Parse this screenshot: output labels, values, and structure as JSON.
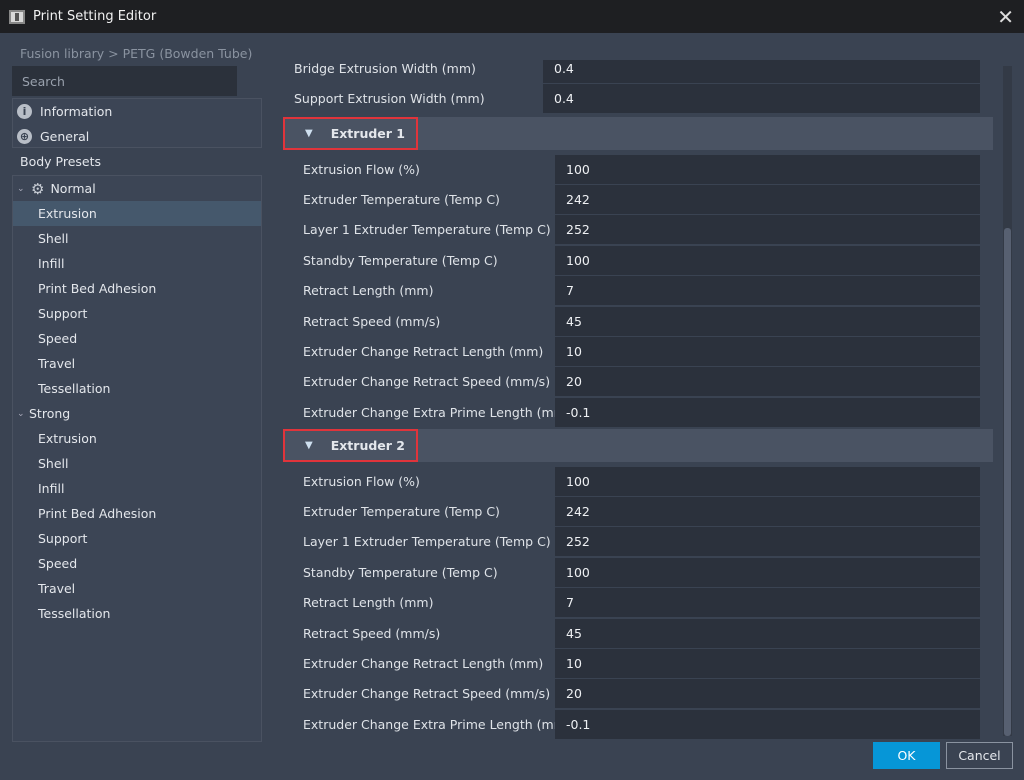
{
  "window": {
    "title": "Print Setting Editor",
    "close_icon": "close-icon"
  },
  "sidebar": {
    "breadcrumb": "Fusion library > PETG (Bowden Tube)",
    "search_placeholder": "Search",
    "top_items": [
      {
        "label": "Information",
        "icon": "info-icon"
      },
      {
        "label": "General",
        "icon": "globe-icon"
      }
    ],
    "body_presets_label": "Body Presets",
    "presets": [
      {
        "label": "Normal",
        "items": [
          "Extrusion",
          "Shell",
          "Infill",
          "Print Bed Adhesion",
          "Support",
          "Speed",
          "Travel",
          "Tessellation"
        ],
        "selected": "Extrusion"
      },
      {
        "label": "Strong",
        "items": [
          "Extrusion",
          "Shell",
          "Infill",
          "Print Bed Adhesion",
          "Support",
          "Speed",
          "Travel",
          "Tessellation"
        ]
      }
    ]
  },
  "main": {
    "pre_rows": [
      {
        "label": "Bridge Extrusion Width (mm)",
        "value": "0.4"
      },
      {
        "label": "Support Extrusion Width (mm)",
        "value": "0.4"
      }
    ],
    "sections": [
      {
        "title": "Extruder 1",
        "rows": [
          {
            "label": "Extrusion Flow (%)",
            "value": "100"
          },
          {
            "label": "Extruder Temperature (Temp C)",
            "value": "242"
          },
          {
            "label": "Layer 1 Extruder Temperature (Temp C)",
            "value": "252"
          },
          {
            "label": "Standby Temperature (Temp C)",
            "value": "100"
          },
          {
            "label": "Retract Length (mm)",
            "value": "7"
          },
          {
            "label": "Retract Speed (mm/s)",
            "value": "45"
          },
          {
            "label": "Extruder Change Retract Length (mm)",
            "value": "10"
          },
          {
            "label": "Extruder Change Retract Speed (mm/s)",
            "value": "20"
          },
          {
            "label": "Extruder Change Extra Prime Length (mm)",
            "value": "-0.1"
          }
        ]
      },
      {
        "title": "Extruder 2",
        "rows": [
          {
            "label": "Extrusion Flow (%)",
            "value": "100"
          },
          {
            "label": "Extruder Temperature (Temp C)",
            "value": "242"
          },
          {
            "label": "Layer 1 Extruder Temperature (Temp C)",
            "value": "252"
          },
          {
            "label": "Standby Temperature (Temp C)",
            "value": "100"
          },
          {
            "label": "Retract Length (mm)",
            "value": "7"
          },
          {
            "label": "Retract Speed (mm/s)",
            "value": "45"
          },
          {
            "label": "Extruder Change Retract Length (mm)",
            "value": "10"
          },
          {
            "label": "Extruder Change Retract Speed (mm/s)",
            "value": "20"
          },
          {
            "label": "Extruder Change Extra Prime Length (mm)",
            "value": "-0.1"
          }
        ]
      }
    ]
  },
  "footer": {
    "ok": "OK",
    "cancel": "Cancel"
  },
  "colors": {
    "accent": "#0696d7",
    "highlight_border": "#e0343b",
    "selected": "#45586c"
  }
}
